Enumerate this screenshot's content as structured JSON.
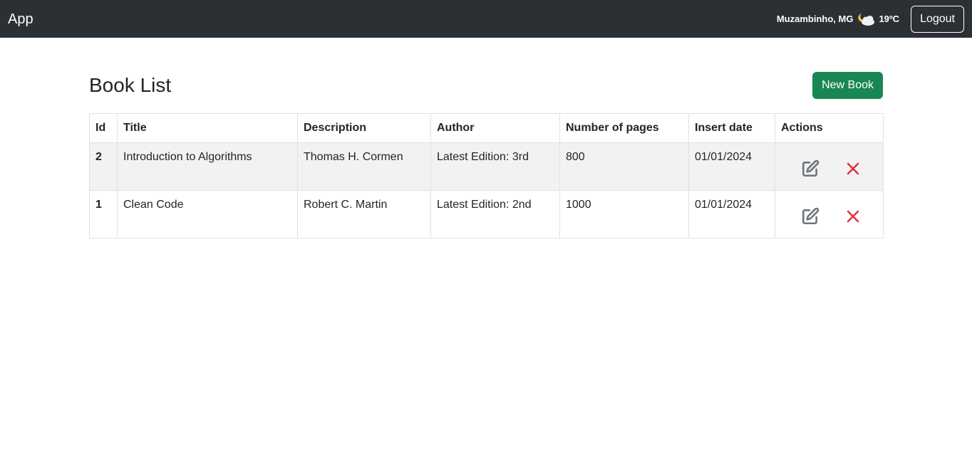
{
  "navbar": {
    "brand": "App",
    "location": "Muzambinho, MG",
    "weather_icon": "partly-cloudy-night-icon",
    "temperature": "19ºC",
    "logout_label": "Logout"
  },
  "page": {
    "title": "Book List",
    "new_book_label": "New Book"
  },
  "table": {
    "columns": [
      "Id",
      "Title",
      "Description",
      "Author",
      "Number of pages",
      "Insert date",
      "Actions"
    ],
    "rows": [
      {
        "id": "2",
        "title": "Introduction to Algorithms",
        "description": "Thomas H. Cormen",
        "author": "Latest Edition: 3rd",
        "pages": "800",
        "insert_date": "01/01/2024"
      },
      {
        "id": "1",
        "title": "Clean Code",
        "description": "Robert C. Martin",
        "author": "Latest Edition: 2nd",
        "pages": "1000",
        "insert_date": "01/01/2024"
      }
    ],
    "action_icons": [
      "edit-icon",
      "delete-icon"
    ]
  },
  "colors": {
    "navbar_bg": "#2b3035",
    "success": "#198754",
    "danger": "#dc3545",
    "edit_icon": "#6c757d",
    "striped_row": "#f2f2f2"
  }
}
